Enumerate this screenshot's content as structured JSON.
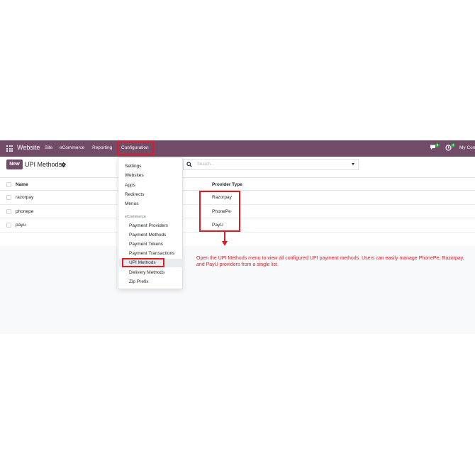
{
  "navbar": {
    "brand": "Website",
    "menu": [
      "Site",
      "eCommerce",
      "Reporting",
      "Configuration"
    ],
    "messages_count": "8",
    "activities_count": "4",
    "company": "My Con",
    "bg_color": "#714B67"
  },
  "control": {
    "new_label": "New",
    "title": "UPI Methods",
    "search_placeholder": "Search..."
  },
  "list": {
    "columns": [
      "Name",
      "Provider Type"
    ],
    "rows": [
      {
        "name": "razorpay",
        "provider": "Razorpay"
      },
      {
        "name": "phonepe",
        "provider": "PhonePe"
      },
      {
        "name": "payu",
        "provider": "PayU"
      }
    ]
  },
  "dropdown": {
    "items": [
      "Settings",
      "Websites",
      "Apps",
      "Redirects",
      "Menus"
    ],
    "section": "eCommerce",
    "sub_items": [
      "Payment Providers",
      "Payment Methods",
      "Payment Tokens",
      "Payment Transactions",
      "UPI Methods",
      "Delivery Methods",
      "Zip Prefix"
    ],
    "active": "UPI Methods"
  },
  "annotation": {
    "text": "Open the UPI Methods menu to view all configured UPI payment methods. Users can easily manage PhonePe, Razorpay, and PayU providers from a single list.",
    "color": "#e01b24"
  }
}
